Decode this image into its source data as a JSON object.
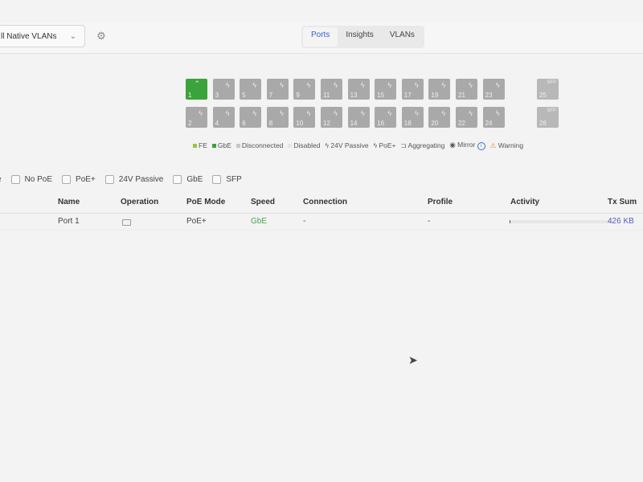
{
  "header": {
    "vlan_select": "ll Native VLANs",
    "tabs": [
      "Ports",
      "Insights",
      "VLANs"
    ],
    "active_tab": "Ports"
  },
  "ports": {
    "top_row": [
      "1",
      "3",
      "5",
      "7",
      "9",
      "11",
      "13",
      "15",
      "17",
      "19",
      "21",
      "23"
    ],
    "bottom_row": [
      "2",
      "4",
      "6",
      "8",
      "10",
      "12",
      "14",
      "16",
      "18",
      "20",
      "22",
      "24"
    ],
    "sfp": [
      "25",
      "26"
    ],
    "sfp_label": "SFP",
    "active_port": "1"
  },
  "legend": {
    "fe": "FE",
    "gbe": "GbE",
    "disconnected": "Disconnected",
    "disabled": "Disabled",
    "passive": "24V Passive",
    "poe_plus": "PoE+",
    "aggregating": "Aggregating",
    "mirror": "Mirror",
    "warning": "Warning"
  },
  "filters": {
    "partial": "e",
    "options": [
      "No PoE",
      "PoE+",
      "24V Passive",
      "GbE",
      "SFP"
    ]
  },
  "table": {
    "headers": {
      "name": "Name",
      "operation": "Operation",
      "poe_mode": "PoE Mode",
      "speed": "Speed",
      "connection": "Connection",
      "profile": "Profile",
      "activity": "Activity",
      "tx_sum": "Tx Sum"
    },
    "rows": [
      {
        "name": "Port 1",
        "poe_mode": "PoE+",
        "speed": "GbE",
        "connection": "-",
        "profile": "-",
        "activity_level": 0.01,
        "tx_sum": "426 KB"
      }
    ]
  },
  "colors": {
    "accent": "#3b5ed8",
    "active_port": "#3aa33a",
    "inactive_port": "#a9a9a9",
    "fe": "#9bc53d",
    "gbe": "#3aa33a",
    "tx_sum": "#5a59c8"
  }
}
